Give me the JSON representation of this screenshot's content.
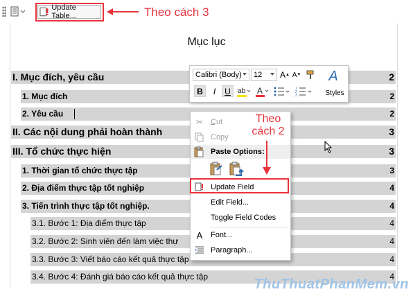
{
  "toc_toolbar": {
    "update_table_label": "Update Table..."
  },
  "annotations": {
    "method3": "Theo cách 3",
    "method2": "Theo\ncách 2",
    "accent_color": "#e8333c"
  },
  "document": {
    "title": "Mục lục",
    "toc": [
      {
        "text": "I. Mục đích, yêu cầu",
        "page": "2",
        "level": 1
      },
      {
        "text": "1. Mục đích",
        "page": "2",
        "level": 2
      },
      {
        "text": "2. Yêu cầu",
        "page": "2",
        "level": 2
      },
      {
        "text": "II. Các nội dung phải hoàn thành",
        "page": "3",
        "level": 1
      },
      {
        "text": "III. Tổ chức thực hiện",
        "page": "3",
        "level": 1
      },
      {
        "text": "1. Thời gian tổ chức thực tập",
        "page": "3",
        "level": 2
      },
      {
        "text": "2. Địa điểm thực tập tốt nghiệp",
        "page": "4",
        "level": 2
      },
      {
        "text": "3. Tiến trình thực tập tốt nghiệp.",
        "page": "4",
        "level": 2
      },
      {
        "text": "3.1. Bước 1: Địa điểm thực tập",
        "page": "4",
        "level": 3
      },
      {
        "text": "3.2. Bước 2: Sinh viên đến làm việc thự",
        "page": "4",
        "level": 3
      },
      {
        "text": "3.3. Bước 3: Viết báo cáo kết quả thực tập",
        "page": "4",
        "level": 3
      },
      {
        "text": "3.4. Bước 4: Đánh giá báo cáo kết quả thực tập",
        "page": "4",
        "level": 3
      }
    ]
  },
  "mini_toolbar": {
    "font_name": "Calibri (Body)",
    "font_size": "12",
    "bold": "B",
    "italic": "I",
    "underline": "U",
    "styles_label": "Styles"
  },
  "context_menu": {
    "cut": "Cut",
    "copy": "Copy",
    "paste_options": "Paste Options:",
    "update_field": "Update Field",
    "edit_field": "Edit Field...",
    "toggle_field_codes": "Toggle Field Codes",
    "font": "Font...",
    "paragraph": "Paragraph..."
  },
  "watermark": "ThuThuatPhanMem.vn"
}
